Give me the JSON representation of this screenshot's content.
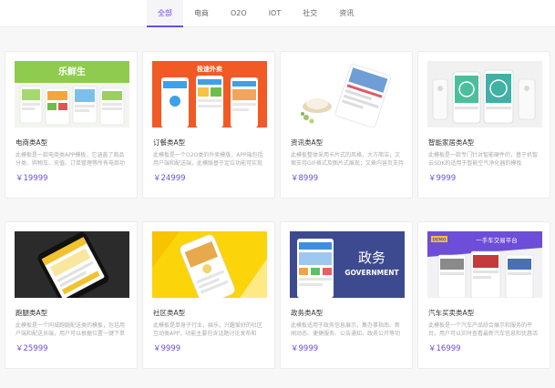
{
  "nav": {
    "tabs": [
      {
        "label": "全部",
        "active": true
      },
      {
        "label": "电商"
      },
      {
        "label": "O2O"
      },
      {
        "label": "IOT"
      },
      {
        "label": "社交"
      },
      {
        "label": "资讯"
      }
    ]
  },
  "colors": {
    "accent": "#6a4fdc"
  },
  "cards": [
    {
      "title": "电商类A型",
      "desc": "此模板是一款电商类APP模板，它涵盖了商品分类、购物车、充值、订单管理等所有电商功能",
      "price": "￥19999",
      "image": "ecommerce-screens-preview",
      "image_text": "乐鲜生"
    },
    {
      "title": "订餐类A型",
      "desc": "此模板是一个O2O类的外卖模版，APP端包括用户端和配送端，此模版基于定位功能可实现查找附近餐厅",
      "price": "￥24999",
      "image": "food-delivery-phones-preview",
      "image_text": "极速外卖"
    },
    {
      "title": "资讯类A型",
      "desc": "此模板整体采用卡片式的风格，大方简洁，文案支持GIF格式及图片式展现；文章内容页支持图文混排",
      "price": "￥8999",
      "image": "news-app-cards-preview"
    },
    {
      "title": "智能家居类A型",
      "desc": "此模板是一款专门针对智能硬件的，基于机智云SDK的适用于智能空气净化器的模板",
      "price": "￥9999",
      "image": "smart-home-devices-preview"
    },
    {
      "title": "跑腿类A型",
      "desc": "此模板是一个同城跑腿配送类的模板，包括用户端和配送员端，用户可以根据位置一键下单",
      "price": "￥25999",
      "image": "errand-phone-preview"
    },
    {
      "title": "社区类A型",
      "desc": "此模板是单身子行业，娱乐，兴趣爱好的社区互动类APP，功能主要包含话题讨论发布和",
      "price": "￥9999",
      "image": "community-phone-preview"
    },
    {
      "title": "政务类A型",
      "desc": "此模板适用于政务信息展示，集办事指南、新闻动态、便捷服务、公告通知、政务公开等功能于一体",
      "price": "￥9999",
      "image": "government-app-preview",
      "image_text": "政务",
      "image_subtext": "GOVERNMENT"
    },
    {
      "title": "汽车买卖类A型",
      "desc": "此模板是一个汽车产品综合展示和服务的平台，用户可以实时查看最新汽车信息和优惠活动",
      "price": "￥16999",
      "image": "car-sales-app-preview",
      "image_text": "一手车交易平台",
      "image_badge": "DEMO"
    }
  ]
}
